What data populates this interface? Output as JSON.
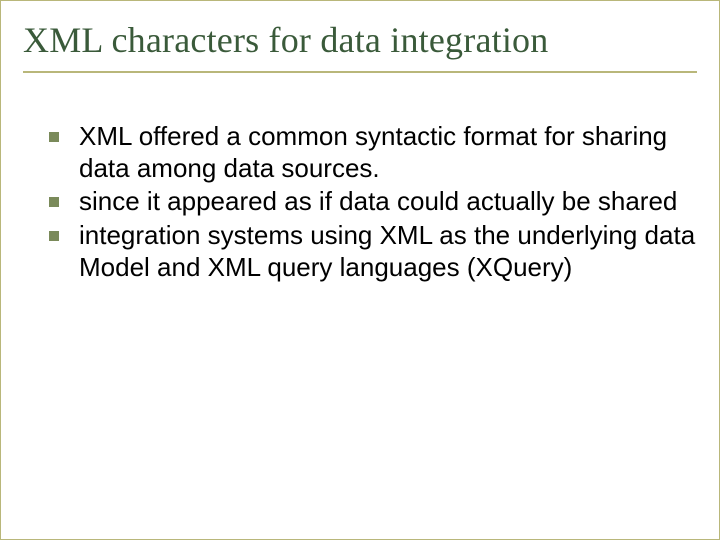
{
  "title": "XML characters for data integration",
  "bullets": [
    "XML offered a common syntactic format for sharing data among data sources.",
    "since it appeared as if data could actually be shared",
    "integration systems using XML as the underlying data Model and XML query languages (XQuery)"
  ]
}
